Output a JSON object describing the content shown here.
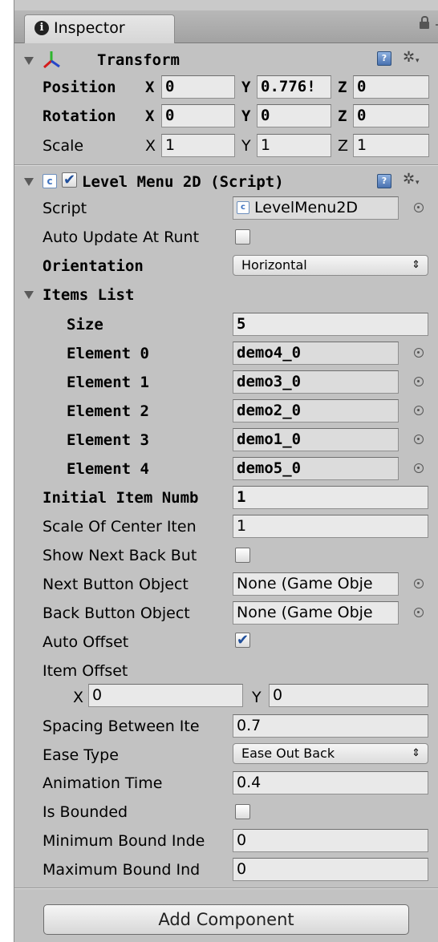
{
  "tab": {
    "title": "Inspector"
  },
  "transform": {
    "title": "Transform",
    "position": {
      "label": "Position",
      "x": "0",
      "y": "0.776!",
      "z": "0"
    },
    "rotation": {
      "label": "Rotation",
      "x": "0",
      "y": "0",
      "z": "0"
    },
    "scale": {
      "label": "Scale",
      "x": "1",
      "y": "1",
      "z": "1"
    },
    "axes": {
      "x": "X",
      "y": "Y",
      "z": "Z"
    }
  },
  "level_menu": {
    "title": "Level Menu 2D (Script)",
    "enabled": true,
    "script_label": "Script",
    "script_value": "LevelMenu2D",
    "auto_update_label": "Auto Update At Runt",
    "auto_update_checked": false,
    "orientation_label": "Orientation",
    "orientation_value": "Horizontal",
    "items_list_label": "Items List",
    "size_label": "Size",
    "size_value": "5",
    "elements": [
      {
        "label": "Element 0",
        "value": "demo4_0"
      },
      {
        "label": "Element 1",
        "value": "demo3_0"
      },
      {
        "label": "Element 2",
        "value": "demo2_0"
      },
      {
        "label": "Element 3",
        "value": "demo1_0"
      },
      {
        "label": "Element 4",
        "value": "demo5_0"
      }
    ],
    "initial_item_label": "Initial Item Numb",
    "initial_item_value": "1",
    "scale_center_label": "Scale Of Center Iten",
    "scale_center_value": "1",
    "show_next_back_label": "Show Next Back But",
    "show_next_back_checked": false,
    "next_button_label": "Next Button Object",
    "next_button_value": "None (Game Obje",
    "back_button_label": "Back Button Object",
    "back_button_value": "None (Game Obje",
    "auto_offset_label": "Auto Offset",
    "auto_offset_checked": true,
    "item_offset_label": "Item Offset",
    "item_offset_x": "0",
    "item_offset_y": "0",
    "spacing_label": "Spacing Between Ite",
    "spacing_value": "0.7",
    "ease_type_label": "Ease Type",
    "ease_type_value": "Ease Out Back",
    "animation_time_label": "Animation Time",
    "animation_time_value": "0.4",
    "is_bounded_label": "Is Bounded",
    "is_bounded_checked": false,
    "min_bound_label": "Minimum Bound Inde",
    "min_bound_value": "0",
    "max_bound_label": "Maximum Bound Ind",
    "max_bound_value": "0"
  },
  "add_component_label": "Add Component",
  "icons": {
    "info": "info-icon",
    "lock": "lock-icon",
    "transform": "transform-axes-icon",
    "help": "help-book-icon",
    "gear": "gear-icon",
    "script": "script-icon",
    "picker": "object-picker-icon"
  },
  "colors": {
    "panel_bg": "#c2c2c2",
    "field_bg": "#e9e9e9",
    "check": "#1f4e9a"
  },
  "glyphs": {
    "check": "✔",
    "arrows": "⇕",
    "gear": "✲",
    "info": "i",
    "help": "?",
    "script": "c"
  }
}
